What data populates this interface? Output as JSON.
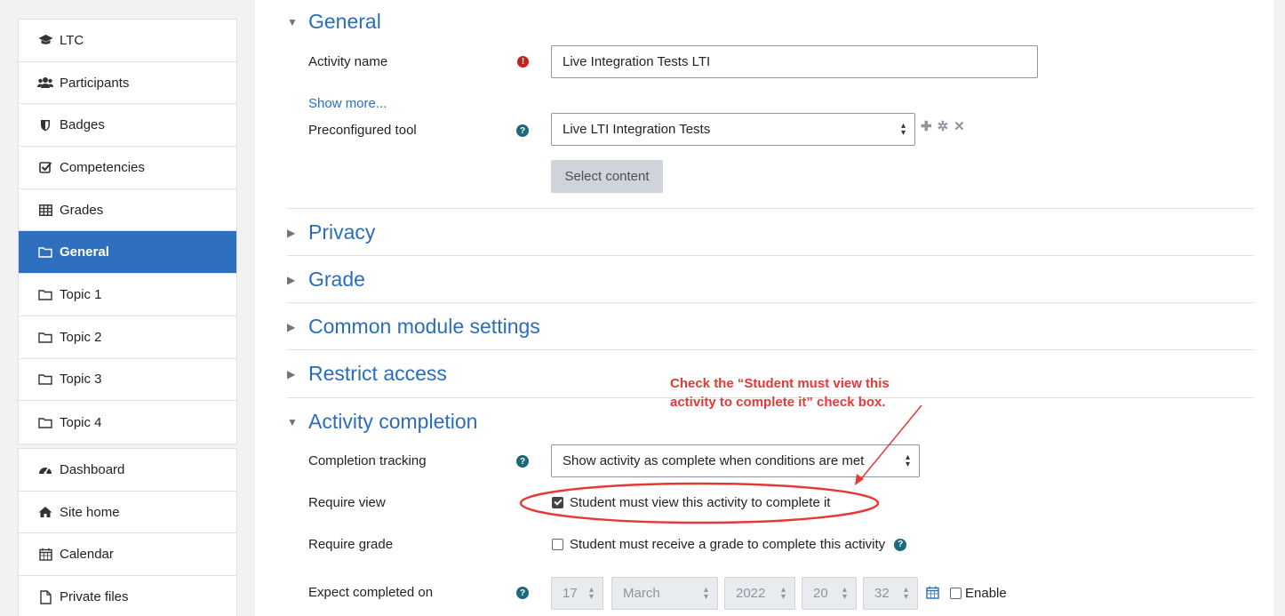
{
  "sidebar": {
    "top_items": [
      {
        "label": "LTC",
        "icon": "graduation-cap-icon"
      },
      {
        "label": "Participants",
        "icon": "users-icon"
      },
      {
        "label": "Badges",
        "icon": "shield-icon"
      },
      {
        "label": "Competencies",
        "icon": "check-square-icon"
      },
      {
        "label": "Grades",
        "icon": "table-icon"
      },
      {
        "label": "General",
        "icon": "folder-icon",
        "active": true
      },
      {
        "label": "Topic 1",
        "icon": "folder-icon"
      },
      {
        "label": "Topic 2",
        "icon": "folder-icon"
      },
      {
        "label": "Topic 3",
        "icon": "folder-icon"
      },
      {
        "label": "Topic 4",
        "icon": "folder-icon"
      }
    ],
    "bottom_items": [
      {
        "label": "Dashboard",
        "icon": "dashboard-icon"
      },
      {
        "label": "Site home",
        "icon": "home-icon"
      },
      {
        "label": "Calendar",
        "icon": "calendar-icon"
      },
      {
        "label": "Private files",
        "icon": "file-icon"
      }
    ]
  },
  "sections": {
    "general": "General",
    "privacy": "Privacy",
    "grade": "Grade",
    "common": "Common module settings",
    "restrict": "Restrict access",
    "completion": "Activity completion"
  },
  "general": {
    "activity_name_label": "Activity name",
    "activity_name_value": "Live Integration Tests LTI",
    "show_more": "Show more...",
    "preconfigured_label": "Preconfigured tool",
    "preconfigured_value": "Live LTI Integration Tests",
    "select_content": "Select content"
  },
  "completion": {
    "tracking_label": "Completion tracking",
    "tracking_value": "Show activity as complete when conditions are met",
    "require_view_label": "Require view",
    "require_view_text": "Student must view this activity to complete it",
    "require_view_checked": true,
    "require_grade_label": "Require grade",
    "require_grade_text": "Student must receive a grade to complete this activity",
    "require_grade_checked": false,
    "expect_label": "Expect completed on",
    "day": "17",
    "month": "March",
    "year": "2022",
    "hour": "20",
    "minute": "32",
    "enable": "Enable"
  },
  "annotation": {
    "line1": "Check the “Student must view this",
    "line2": "activity to complete it” check box.",
    "color": "#e53935"
  },
  "colors": {
    "accent": "#2a6ebb",
    "active_nav": "#2e6fc0"
  }
}
